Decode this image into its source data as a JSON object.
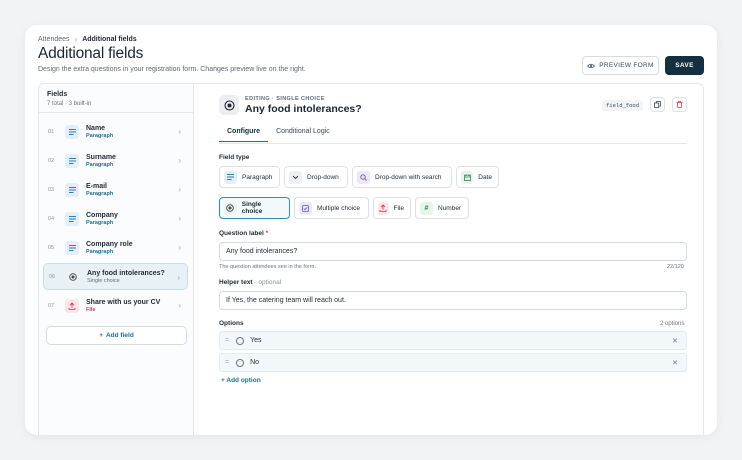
{
  "breadcrumb": {
    "parent": "Attendees",
    "current": "Additional fields"
  },
  "page": {
    "title": "Additional fields",
    "subtitle": "Design the extra questions in your registration form. Changes preview live on the right."
  },
  "actions": {
    "preview_label": "PREVIEW FORM",
    "save_label": "SAVE"
  },
  "sidebar": {
    "heading": "Fields",
    "summary": "7 total · 3 built-in",
    "items": [
      {
        "num": "01",
        "name": "Name",
        "type": "Paragraph",
        "icon": "paragraph-icon"
      },
      {
        "num": "02",
        "name": "Surname",
        "type": "Paragraph",
        "icon": "paragraph-icon"
      },
      {
        "num": "03",
        "name": "E-mail",
        "type": "Paragraph",
        "icon": "paragraph-icon"
      },
      {
        "num": "04",
        "name": "Company",
        "type": "Paragraph",
        "icon": "paragraph-icon"
      },
      {
        "num": "05",
        "name": "Company role",
        "type": "Paragraph",
        "icon": "paragraph-icon"
      },
      {
        "num": "06",
        "name": "Any food intolerances?",
        "type": "Single choice",
        "icon": "radio-icon",
        "selected": true
      },
      {
        "num": "07",
        "name": "Share with us your CV",
        "type": "File",
        "icon": "upload-icon"
      }
    ],
    "add_label": "Add field"
  },
  "editor": {
    "kicker": "EDITING · SINGLE CHOICE",
    "title": "Any food intolerances?",
    "field_key": "field_food",
    "tabs": [
      {
        "label": "Configure",
        "active": true
      },
      {
        "label": "Conditional Logic",
        "active": false
      }
    ],
    "field_type_label": "Field type",
    "field_types": [
      {
        "label": "Paragraph",
        "icon": "paragraph-icon"
      },
      {
        "label": "Drop-down",
        "icon": "dropdown-icon"
      },
      {
        "label": "Drop-down with search",
        "icon": "search-icon"
      },
      {
        "label": "Date",
        "icon": "calendar-icon"
      },
      {
        "label": "Single choice",
        "icon": "radio-icon",
        "selected": true
      },
      {
        "label": "Multiple choice",
        "icon": "checkbox-icon"
      },
      {
        "label": "File",
        "icon": "upload-icon"
      },
      {
        "label": "Number",
        "icon": "hash-icon"
      }
    ],
    "question_label": "Question label",
    "question_required_mark": "*",
    "question_value": "Any food intolerances?",
    "question_hint": "The question attendees see in the form.",
    "question_count": "22/120",
    "helper_label": "Helper text",
    "helper_optional": "· optional",
    "helper_value": "If Yes, the catering team will reach out.",
    "options_label": "Options",
    "options_count": "2 options",
    "options": [
      "Yes",
      "No"
    ],
    "add_option_label": "Add option"
  },
  "colors": {
    "accent": "#1e6f8f",
    "save_bg": "#14303f",
    "danger": "#d43b4f"
  }
}
